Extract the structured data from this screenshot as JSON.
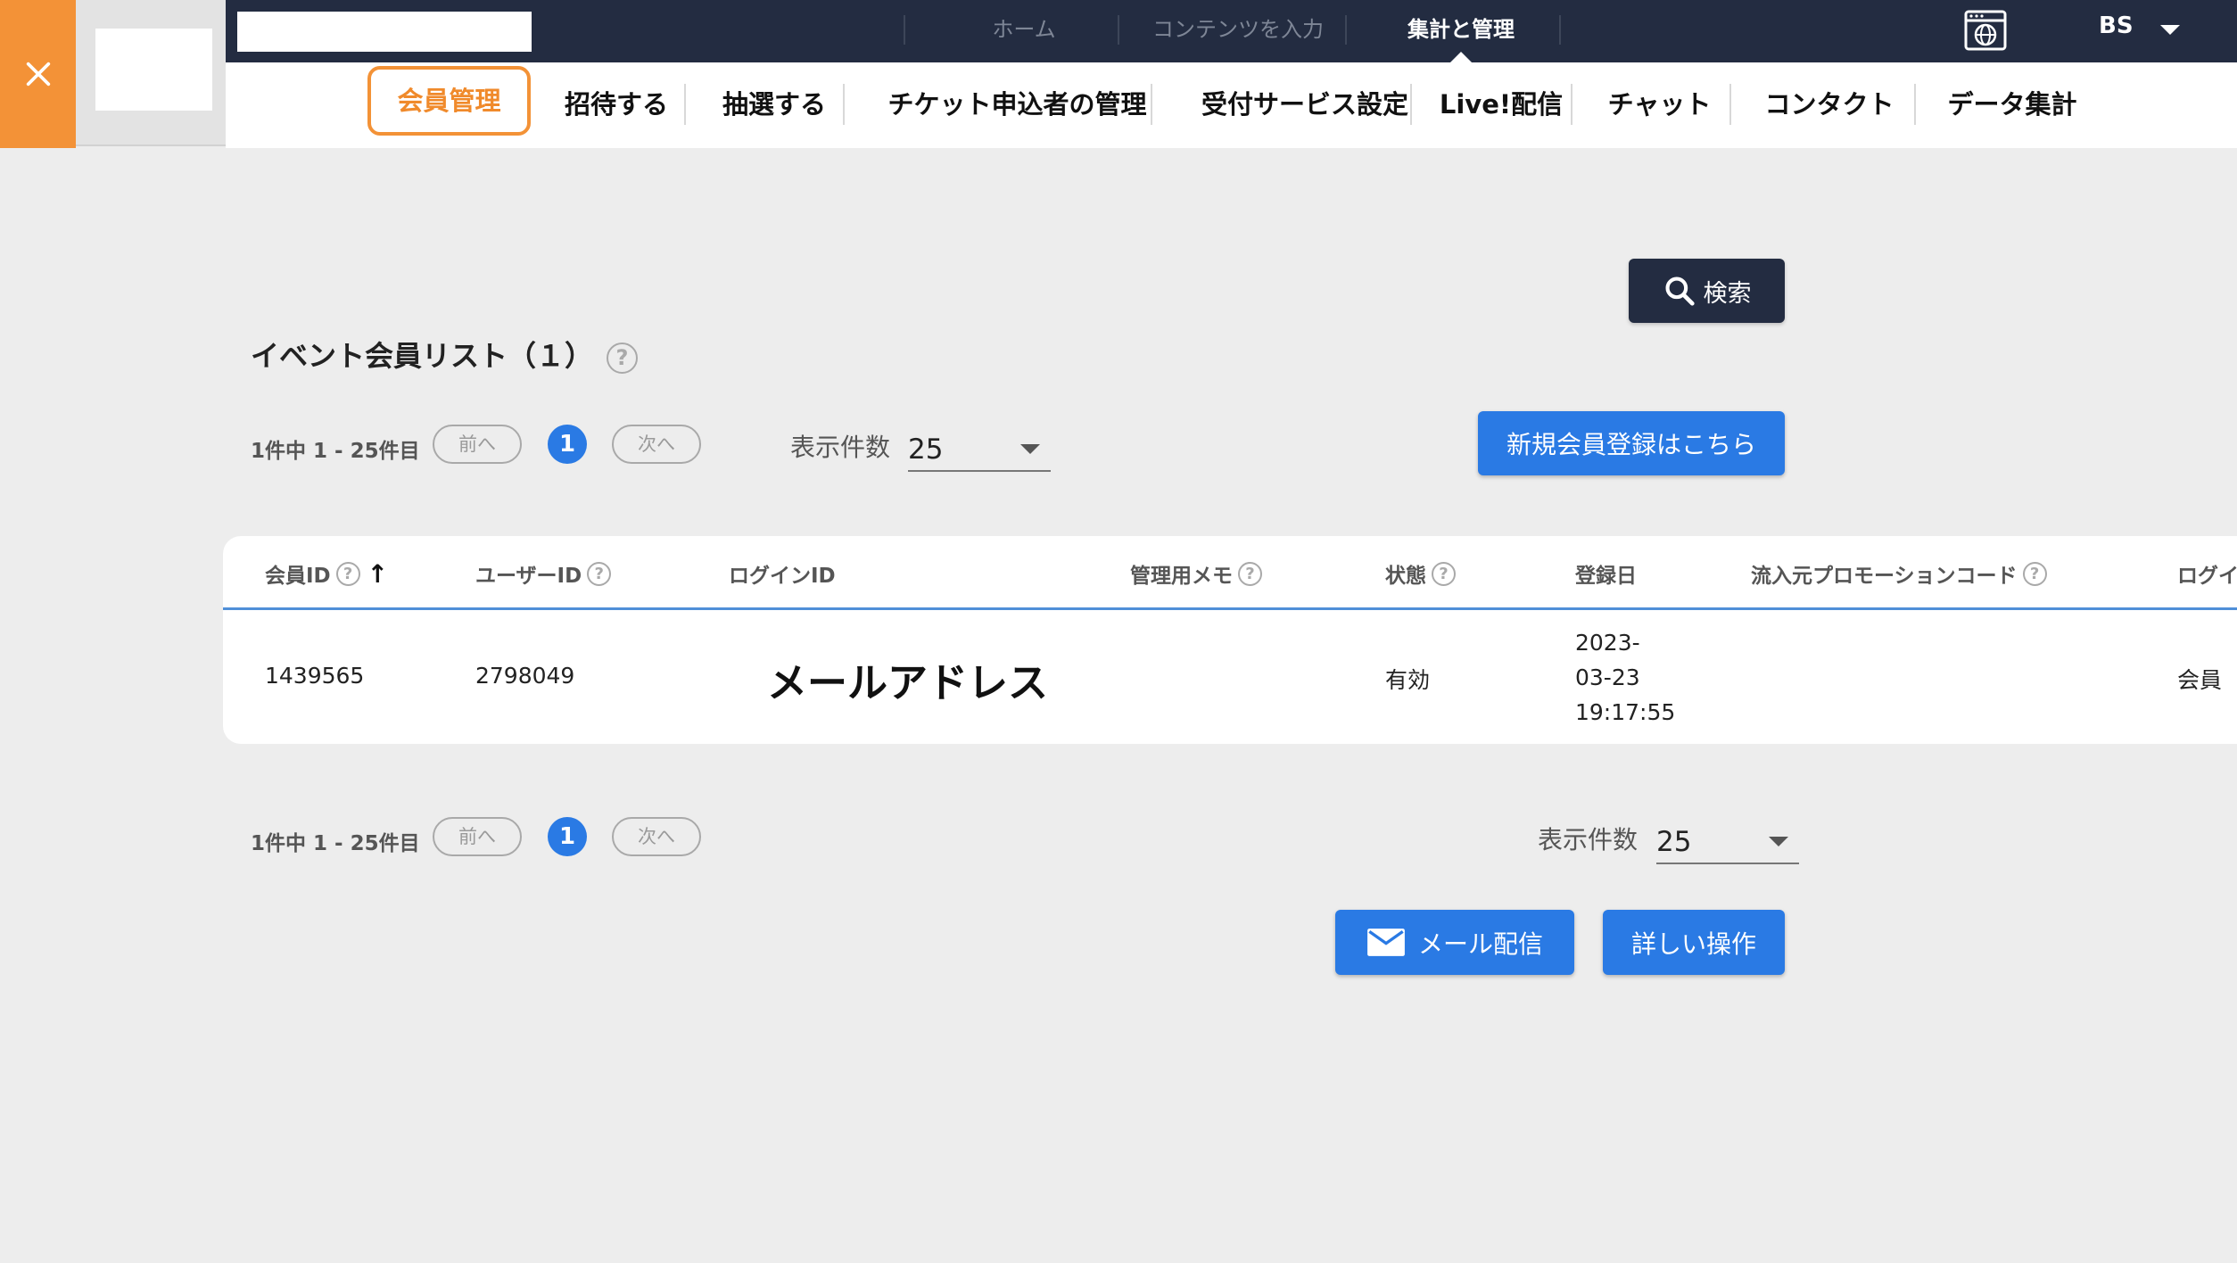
{
  "topnav": {
    "items": [
      {
        "label": "ホーム"
      },
      {
        "label": "コンテンツを入力"
      },
      {
        "label": "集計と管理"
      }
    ],
    "user": "BS"
  },
  "subnav": {
    "tabs": [
      {
        "label": "会員管理"
      },
      {
        "label": "招待する"
      },
      {
        "label": "抽選する"
      },
      {
        "label": "チケット申込者の管理"
      },
      {
        "label": "受付サービス設定"
      },
      {
        "label": "Live!配信"
      },
      {
        "label": "チャット"
      },
      {
        "label": "コンタクト"
      },
      {
        "label": "データ集計"
      }
    ]
  },
  "search": {
    "label": "検索"
  },
  "list": {
    "title": "イベント会員リスト（１）"
  },
  "pager": {
    "count": "1件中 1 - 25件目",
    "prev": "前へ",
    "next": "次へ",
    "current_page": "1"
  },
  "perpage": {
    "label": "表示件数",
    "value": "25"
  },
  "register_button": "新規会員登録はこちら",
  "table": {
    "columns": [
      "会員ID",
      "ユーザーID",
      "ログインID",
      "管理用メモ",
      "状態",
      "登録日",
      "流入元プロモーションコード",
      "ログイ"
    ],
    "rows": [
      {
        "member_id": "1439565",
        "user_id": "2798049",
        "login_id": "メールアドレス",
        "memo": "",
        "status": "有効",
        "date": "2023-03-23 19:17:55",
        "date_line1": "2023-",
        "date_line2": "03-23",
        "date_line3": "19:17:55",
        "promo": "",
        "login_type": "会員"
      }
    ]
  },
  "actions": {
    "mail": "メール配信",
    "detail": "詳しい操作"
  },
  "colors": {
    "accent_orange": "#f39237",
    "navy": "#232c41",
    "primary_blue": "#2a7ae4"
  }
}
